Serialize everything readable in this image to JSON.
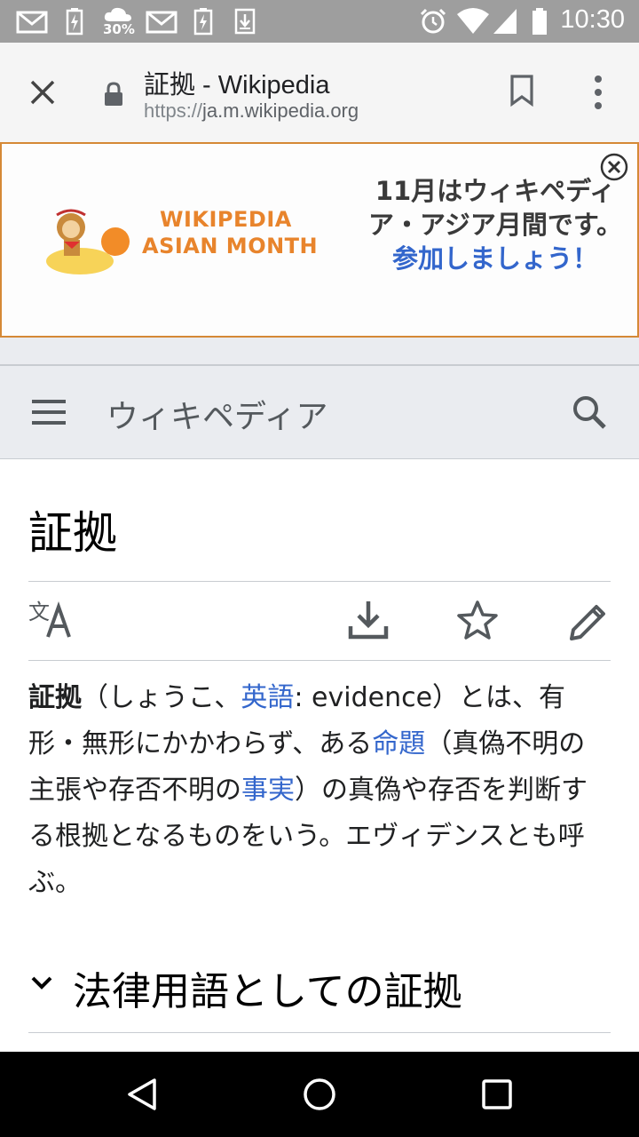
{
  "status_bar": {
    "time": "10:30",
    "battery_percent_label": "30%",
    "icons": [
      "mail-icon",
      "battery-charging-icon",
      "cloud-upload-icon",
      "mail-icon",
      "battery-saver-icon",
      "download-icon",
      "alarm-icon",
      "wifi-icon",
      "signal-icon",
      "battery-icon"
    ]
  },
  "browser": {
    "page_title": "証拠 - Wikipedia",
    "url_protocol": "https://",
    "url_host": "ja.m.wikipedia.org",
    "icons": [
      "close-icon",
      "lock-icon",
      "bookmark-icon",
      "more-vert-icon"
    ]
  },
  "banner": {
    "logo_line1": "WIKIPEDIA",
    "logo_line2": "ASIAN MONTH",
    "text_plain": "11月はウィキペディア・アジア月間です。",
    "text_link": "参加しましょう！",
    "close_icon": "close-circle-icon",
    "accent_color": "#d58936"
  },
  "wiki_header": {
    "site_name": "ウィキペディア",
    "icons": [
      "menu-icon",
      "search-icon"
    ]
  },
  "article": {
    "title": "証拠",
    "action_icons": [
      "language-icon",
      "download-icon",
      "star-icon",
      "edit-icon"
    ],
    "para": {
      "bold": "証拠",
      "t1": "（しょうこ、",
      "link1": "英語",
      "t2": ": evidence）とは、有形・無形にかかわらず、ある",
      "link2": "命題",
      "t3": "（真偽不明の主張や存否不明の",
      "link3": "事実",
      "t4": "）の真偽や存否を判断する根拠となるものをいう。エヴィデンスとも呼ぶ。"
    },
    "section_title": "法律用語としての証拠"
  },
  "nav_bar": {
    "icons": [
      "back-icon",
      "home-icon",
      "recents-icon"
    ]
  },
  "colors": {
    "link": "#3366cc",
    "header_bg": "#eaecf0",
    "status_bg": "#9e9e9e"
  }
}
